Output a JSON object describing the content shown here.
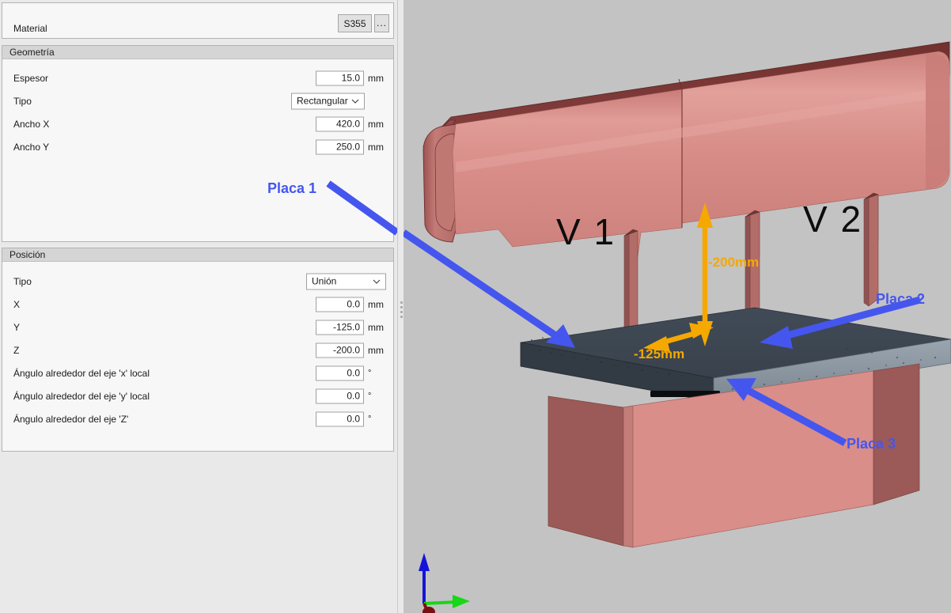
{
  "panel": {
    "material": {
      "title": "Material",
      "label": "Material",
      "value": "S355",
      "browse_label": "..."
    },
    "geometria": {
      "title": "Geometría",
      "rows": [
        {
          "label": "Espesor",
          "value": "15.0",
          "unit": "mm",
          "kind": "number"
        },
        {
          "label": "Tipo",
          "value": "Rectangular",
          "unit": "",
          "kind": "combo"
        },
        {
          "label": "Ancho X",
          "value": "420.0",
          "unit": "mm",
          "kind": "number"
        },
        {
          "label": "Ancho Y",
          "value": "250.0",
          "unit": "mm",
          "kind": "number"
        }
      ]
    },
    "posicion": {
      "title": "Posición",
      "rows": [
        {
          "label": "Tipo",
          "value": "Unión",
          "unit": "",
          "kind": "combo"
        },
        {
          "label": "X",
          "value": "0.0",
          "unit": "mm",
          "kind": "number"
        },
        {
          "label": "Y",
          "value": "-125.0",
          "unit": "mm",
          "kind": "number"
        },
        {
          "label": "Z",
          "value": "-200.0",
          "unit": "mm",
          "kind": "number"
        },
        {
          "label": "Ángulo alrededor del eje 'x' local",
          "value": "0.0",
          "unit": "°",
          "kind": "number"
        },
        {
          "label": "Ángulo alrededor del eje 'y' local",
          "value": "0.0",
          "unit": "°",
          "kind": "number"
        },
        {
          "label": "Ángulo alrededor del eje 'Z'",
          "value": "0.0",
          "unit": "°",
          "kind": "number"
        }
      ]
    }
  },
  "viewport": {
    "annotations": {
      "placa1": "Placa 1",
      "placa2": "Placa 2",
      "placa3": "Placa 3",
      "beam1": "V 1",
      "beam2": "V 2",
      "dim_vertical": "-200mm",
      "dim_horizontal": "-125mm"
    },
    "colors": {
      "background": "#c3c3c3",
      "annotation_blue": "#4556ee",
      "annotation_orange": "#f5a800",
      "steel_red": "#d1817c",
      "steel_red_dark": "#8d4a48",
      "plate_gray": "#3c4550",
      "plate_gray_light": "#8e9aa4",
      "axis_z": "#1414d8",
      "axis_y": "#16d816",
      "axis_x": "#7a1010"
    }
  }
}
